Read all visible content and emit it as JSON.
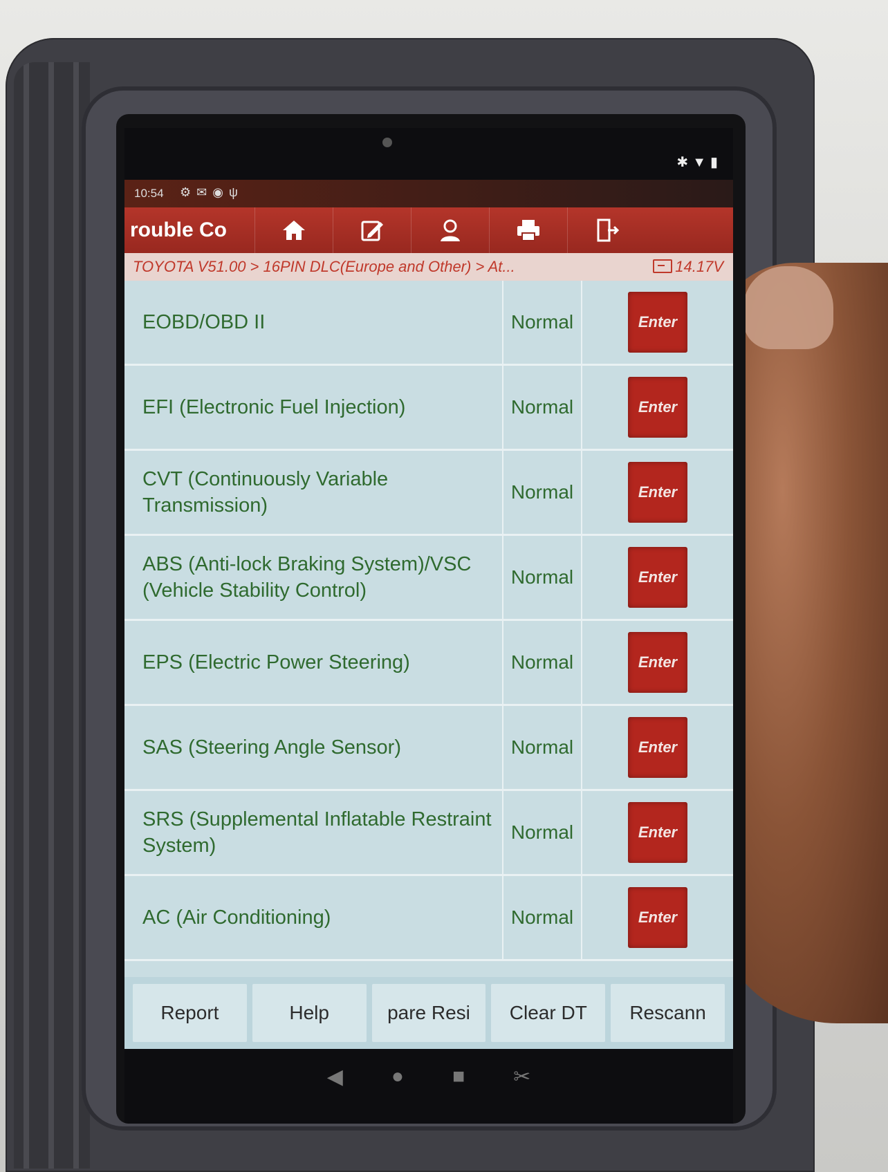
{
  "status_bar": {
    "time": "10:54",
    "left_icons": [
      "settings-icon",
      "mail-icon",
      "obd-icon",
      "vci-icon"
    ],
    "right_icons": [
      "bluetooth-icon",
      "wifi-icon",
      "battery-icon"
    ]
  },
  "header": {
    "title": "rouble Co",
    "nav": [
      {
        "name": "home-icon"
      },
      {
        "name": "edit-report-icon"
      },
      {
        "name": "user-icon"
      },
      {
        "name": "printer-icon"
      },
      {
        "name": "exit-icon"
      }
    ],
    "accent_color": "#b4352a"
  },
  "breadcrumb": {
    "path": "TOYOTA V51.00 > 16PIN DLC(Europe and Other) > At...",
    "voltage": "14.17V"
  },
  "systems": [
    {
      "name": "EOBD/OBD II",
      "status": "Normal",
      "action": "Enter"
    },
    {
      "name": "EFI (Electronic Fuel Injection)",
      "status": "Normal",
      "action": "Enter"
    },
    {
      "name": "CVT (Continuously Variable Transmission)",
      "status": "Normal",
      "action": "Enter"
    },
    {
      "name": "ABS (Anti-lock Braking System)/VSC (Vehicle Stability Control)",
      "status": "Normal",
      "action": "Enter"
    },
    {
      "name": "EPS (Electric Power Steering)",
      "status": "Normal",
      "action": "Enter"
    },
    {
      "name": "SAS (Steering Angle Sensor)",
      "status": "Normal",
      "action": "Enter"
    },
    {
      "name": "SRS (Supplemental Inflatable Restraint System)",
      "status": "Normal",
      "action": "Enter"
    },
    {
      "name": "AC (Air Conditioning)",
      "status": "Normal",
      "action": "Enter"
    }
  ],
  "toolbar": {
    "report": "Report",
    "help": "Help",
    "compare": "pare Resi",
    "clear": "Clear DT",
    "rescan": "Rescann"
  },
  "android_nav": {
    "back": "◀",
    "home": "●",
    "recents": "■",
    "screenshot": "✂"
  }
}
